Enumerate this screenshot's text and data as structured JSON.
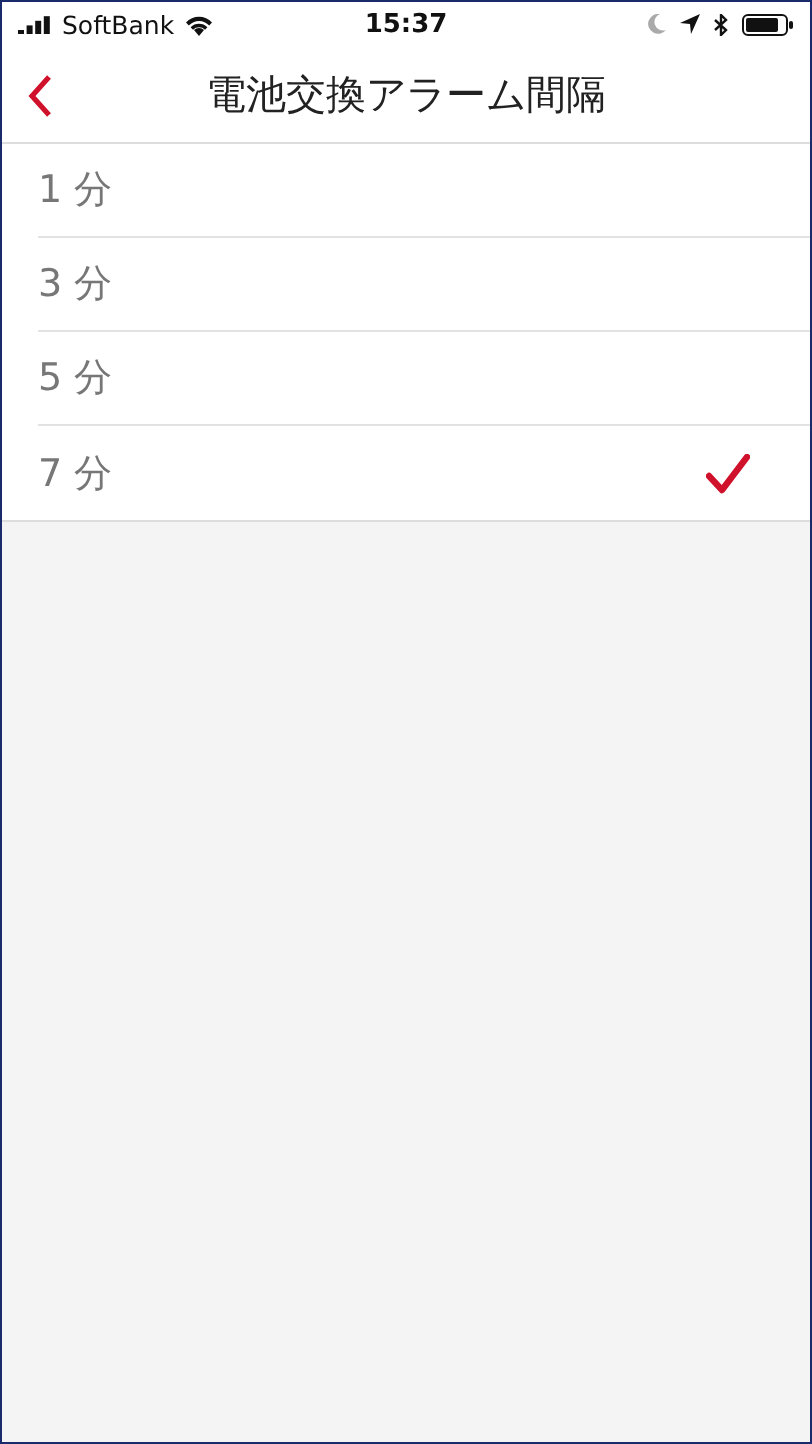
{
  "status_bar": {
    "carrier": "SoftBank",
    "time": "15:37"
  },
  "nav": {
    "title": "電池交換アラーム間隔"
  },
  "options": [
    {
      "label": "1 分",
      "selected": false
    },
    {
      "label": "3 分",
      "selected": false
    },
    {
      "label": "5 分",
      "selected": false
    },
    {
      "label": "7 分",
      "selected": true
    }
  ]
}
